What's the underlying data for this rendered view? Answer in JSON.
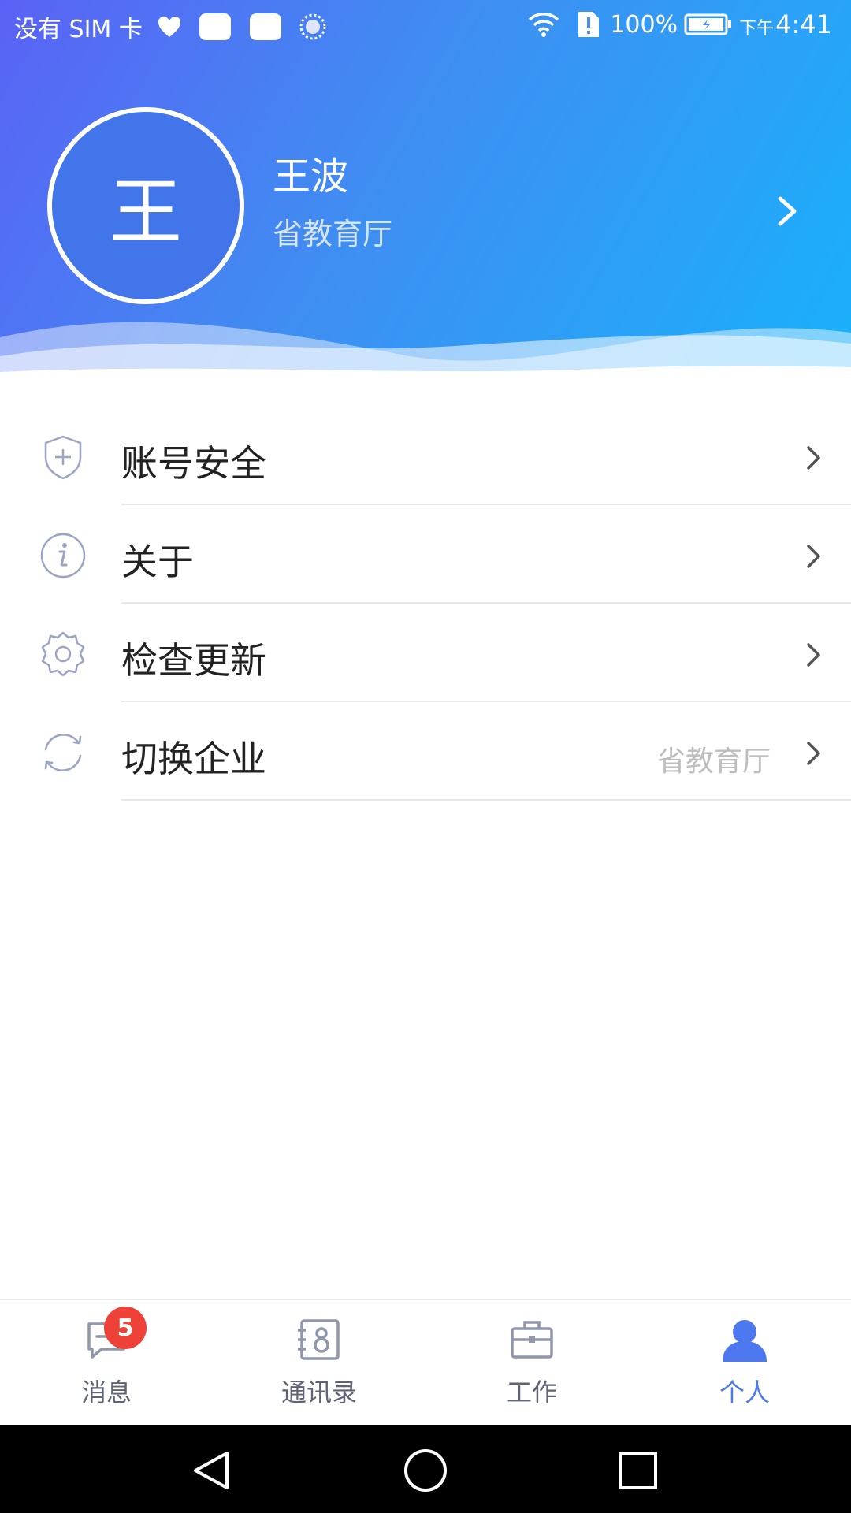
{
  "status_bar": {
    "carrier": "没有 SIM 卡",
    "battery": "100%",
    "ampm": "下午",
    "time": "4:41"
  },
  "profile": {
    "avatar_text": "王",
    "name": "王波",
    "organization": "省教育厅",
    "colors": {
      "gradient_start": "#5a62f5",
      "gradient_end": "#19b1fb",
      "avatar_bg": "#4275ea"
    }
  },
  "menu": {
    "items": [
      {
        "icon": "shield-icon",
        "label": "账号安全",
        "value": ""
      },
      {
        "icon": "info-icon",
        "label": "关于",
        "value": ""
      },
      {
        "icon": "gear-icon",
        "label": "检查更新",
        "value": ""
      },
      {
        "icon": "refresh-icon",
        "label": "切换企业",
        "value": "省教育厅"
      }
    ]
  },
  "tabbar": {
    "active_color": "#4d78f0",
    "tabs": [
      {
        "icon": "message-icon",
        "label": "消息",
        "badge": "5",
        "active": false
      },
      {
        "icon": "contacts-icon",
        "label": "通讯录",
        "active": false
      },
      {
        "icon": "briefcase-icon",
        "label": "工作",
        "active": false
      },
      {
        "icon": "person-icon",
        "label": "个人",
        "active": true
      }
    ]
  },
  "system_nav": {
    "buttons": [
      "back-icon",
      "home-icon",
      "recents-icon"
    ]
  }
}
